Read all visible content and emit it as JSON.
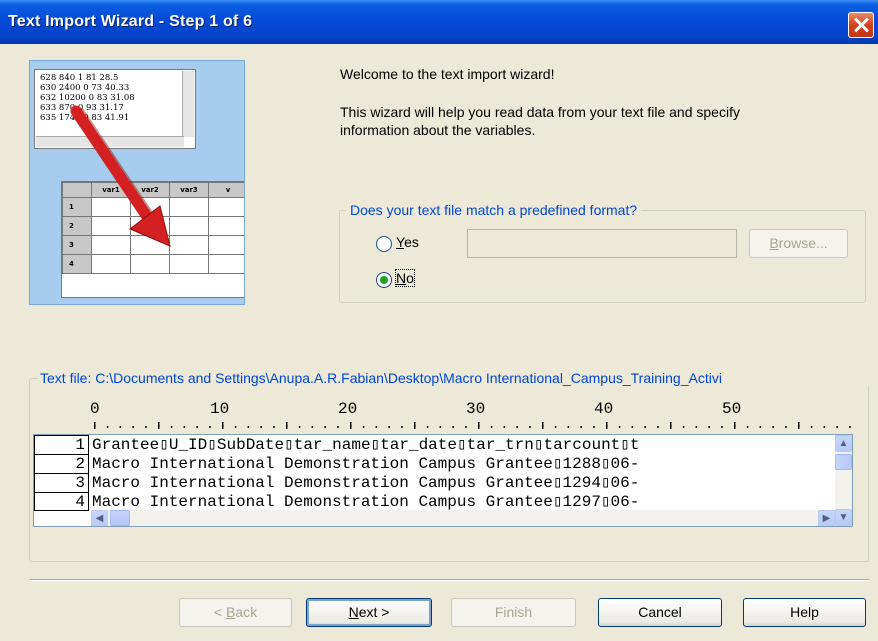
{
  "window": {
    "title": "Text Import Wizard - Step 1 of 6",
    "close_icon": "close-icon"
  },
  "illustration": {
    "data_lines": [
      "628 840 1 81 28.5",
      "630 2400 0 73 40.33",
      "632 10200 0 83 31.08",
      "633 870 0 93 31.17",
      "635 1740 0 83 41.91"
    ],
    "grid_headers": [
      "var1",
      "var2",
      "var3",
      "v"
    ],
    "row_numbers": [
      "1",
      "2",
      "3",
      "4"
    ],
    "arrow_color": "#d42020"
  },
  "intro": {
    "welcome": "Welcome to the text import wizard!",
    "description_line1": "This wizard will help you read data from your text file and specify",
    "description_line2": "information about the variables."
  },
  "format_group": {
    "label": "Does your text file match a predefined format?",
    "yes_prefix": "",
    "yes_accel": "Y",
    "yes_rest": "es",
    "no_accel": "N",
    "no_rest": "o",
    "selected": "No",
    "path_value": "",
    "browse_accel": "B",
    "browse_rest": "rowse..."
  },
  "preview": {
    "label": "Text file: C:\\Documents and Settings\\Anupa.A.R.Fabian\\Desktop\\Macro International_Campus_Training_Activi",
    "ruler": [
      "0",
      "10",
      "20",
      "30",
      "40",
      "50"
    ],
    "line_numbers": [
      "1",
      "2",
      "3",
      "4"
    ],
    "lines": [
      "Grantee▯U_ID▯SubDate▯tar_name▯tar_date▯tar_trn▯tarcount▯t",
      "Macro International Demonstration Campus Grantee▯1288▯06-",
      "Macro International Demonstration Campus Grantee▯1294▯06-",
      "Macro International Demonstration Campus Grantee▯1297▯06-"
    ]
  },
  "buttons": {
    "back_prefix": "< ",
    "back_accel": "B",
    "back_rest": "ack",
    "next_accel": "N",
    "next_rest": "ext >",
    "finish": "Finish",
    "cancel": "Cancel",
    "help": "Help"
  }
}
